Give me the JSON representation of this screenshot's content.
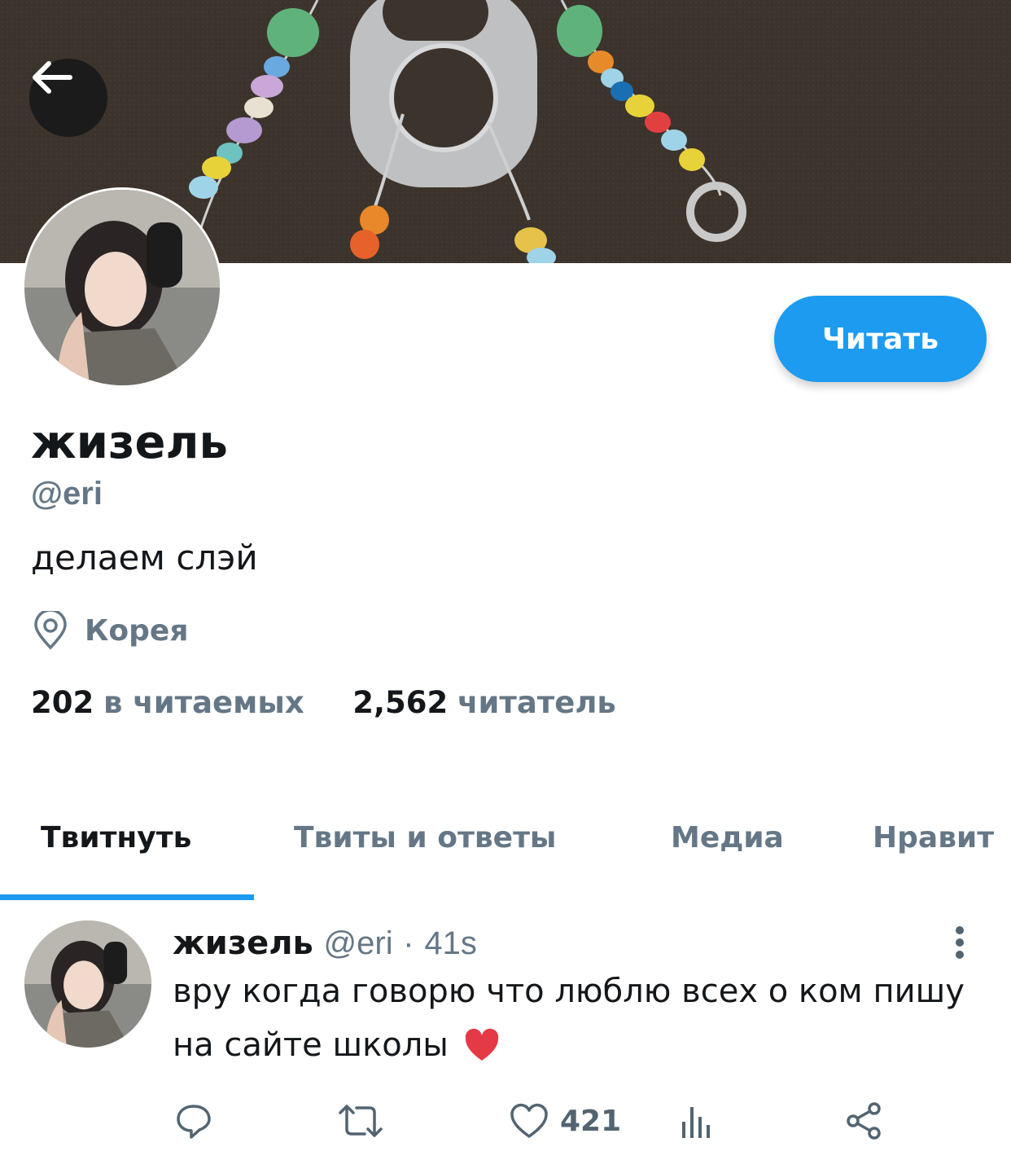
{
  "header": {
    "back_icon": "arrow-left-icon",
    "follow_label": "Читать"
  },
  "profile": {
    "display_name": "жизель",
    "handle": "@eri",
    "bio": "делаем слэй",
    "location_icon": "location-pin-icon",
    "location": "Корея",
    "following_count": "202",
    "following_label": "в читаемых",
    "followers_count": "2,562",
    "followers_label": "читатель"
  },
  "tabs": [
    {
      "label": "Твитнуть",
      "active": true
    },
    {
      "label": "Твиты и ответы",
      "active": false
    },
    {
      "label": "Медиа",
      "active": false
    },
    {
      "label": "Нравит",
      "active": false
    }
  ],
  "tweet": {
    "author_name": "жизель",
    "author_handle": "@eri",
    "separator": "·",
    "time": "41s",
    "text": "вру когда говорю что люблю всех о ком пишу на сайте школы",
    "emoji": "❤️",
    "actions": {
      "reply_icon": "reply-icon",
      "retweet_icon": "retweet-icon",
      "like_icon": "heart-icon",
      "like_count": "421",
      "analytics_icon": "analytics-icon",
      "share_icon": "share-icon"
    }
  },
  "colors": {
    "accent": "#1d9bf0",
    "secondary_text": "#657786",
    "primary_text": "#14171a"
  }
}
